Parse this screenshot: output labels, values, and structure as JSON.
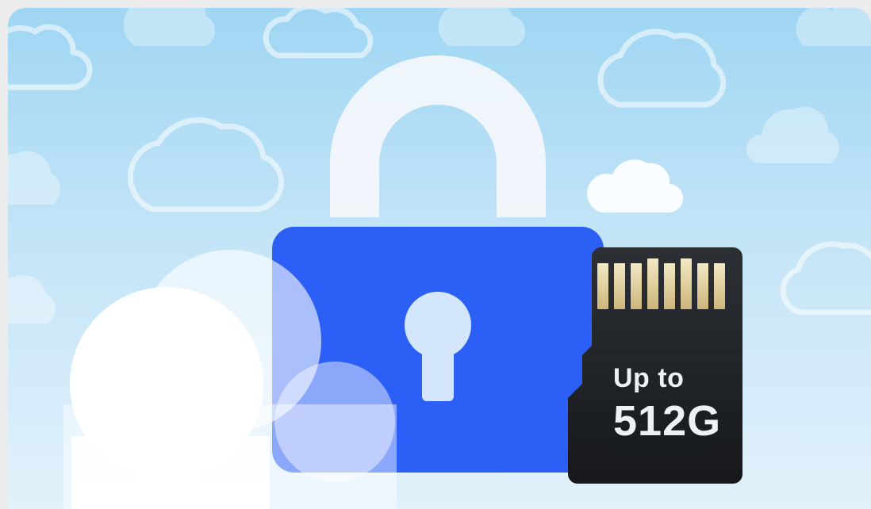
{
  "illustration": {
    "sd_card": {
      "capacity_prefix": "Up to",
      "capacity_value": "512G"
    },
    "icons": [
      "cloud-icon",
      "padlock-icon",
      "keyhole-icon",
      "micro-sd-card-icon"
    ],
    "colors": {
      "sky_top": "#9fd6f3",
      "sky_bottom": "#e2f1fb",
      "lock_body": "#2b5ff5",
      "lock_shackle": "#f4f8fb",
      "sd_card": "#1f2226",
      "sd_contacts": "#e6d7a6",
      "cloud_outline": "#ffffff"
    }
  }
}
